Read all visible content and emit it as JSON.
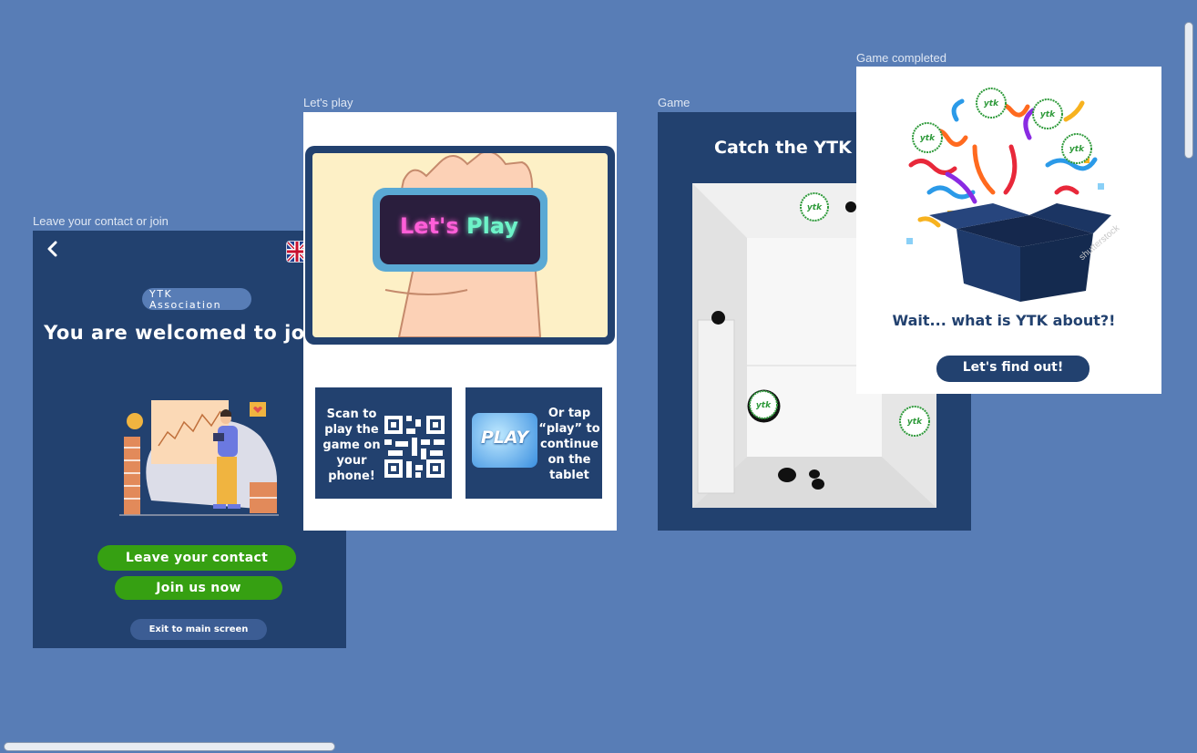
{
  "frames": {
    "contact": {
      "label": "Leave your contact or join",
      "pill": "YTK Association",
      "title": "You are welcomed to join!",
      "leave_button": "Leave your contact",
      "join_button": "Join us now",
      "exit_button": "Exit to main screen",
      "back_icon": "chevron-left-icon",
      "language_icon": "uk-flag-icon"
    },
    "lets_play": {
      "label": "Let's play",
      "banner_text_part1": "Let's",
      "banner_text_part2": "Play",
      "scan_text": "Scan to play the game on your phone!",
      "tap_text": "Or tap “play” to continue on the tablet",
      "play_button": "PLAY"
    },
    "game": {
      "label": "Game",
      "title": "Catch the YTK l",
      "ytk_logo": "ytk"
    },
    "completed": {
      "label": "Game completed",
      "message": "Wait... what is YTK about?!",
      "cta": "Let's find out!",
      "watermark": "shutterstock"
    }
  },
  "colors": {
    "canvas": "#587db6",
    "navy": "#22416f",
    "green_button": "#36a012",
    "cream": "#fdf0c6"
  }
}
